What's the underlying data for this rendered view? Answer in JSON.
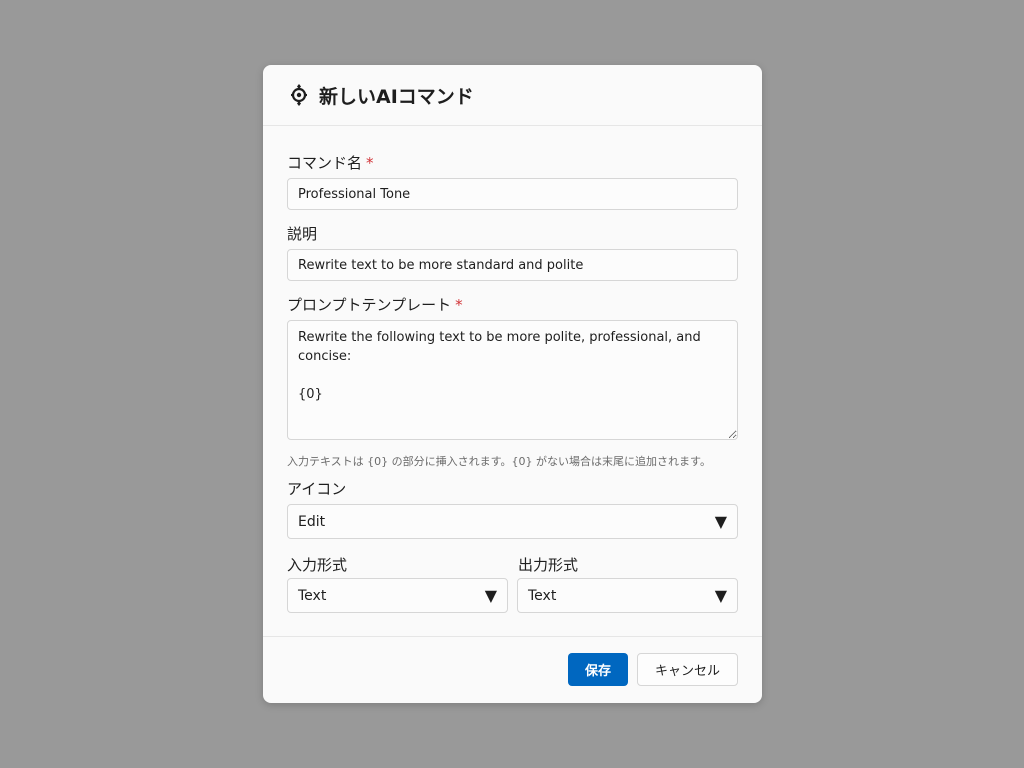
{
  "dialog": {
    "title": "新しいAIコマンド",
    "icon": "ai-sparkle-icon"
  },
  "fields": {
    "name": {
      "label": "コマンド名",
      "required_mark": "*",
      "value": "Professional Tone"
    },
    "description": {
      "label": "説明",
      "value": "Rewrite text to be more standard and polite"
    },
    "prompt": {
      "label": "プロンプトテンプレート",
      "required_mark": "*",
      "value": "Rewrite the following text to be more polite, professional, and concise:\n\n{0}",
      "hint": "入力テキストは {0} の部分に挿入されます。{0} がない場合は末尾に追加されます。"
    },
    "icon": {
      "label": "アイコン",
      "value": "Edit"
    },
    "input_format": {
      "label": "入力形式",
      "value": "Text"
    },
    "output_format": {
      "label": "出力形式",
      "value": "Text"
    }
  },
  "footer": {
    "save_label": "保存",
    "cancel_label": "キャンセル"
  },
  "colors": {
    "accent": "#0067c0",
    "required": "#d13438",
    "overlay": "#999999"
  }
}
